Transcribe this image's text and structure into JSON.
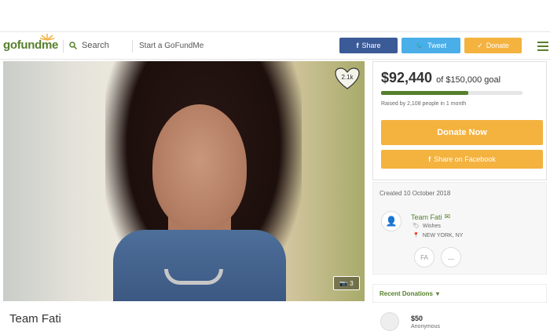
{
  "header": {
    "logo": "gofundme",
    "search_label": "Search",
    "start_label": "Start a GoFundMe",
    "share_label": "Share",
    "tweet_label": "Tweet",
    "donate_label": "Donate"
  },
  "hero": {
    "likes": "2.1k",
    "photos": "3"
  },
  "campaign": {
    "title": "Team Fati",
    "raised": "$92,440",
    "goal_text": "of $150,000 goal",
    "progress_fraction": 0.616,
    "raised_by": "Raised by 2,108 people in 1 month",
    "donate_now": "Donate Now",
    "share_facebook": "Share on Facebook"
  },
  "organizer": {
    "created": "Created 10 October 2018",
    "name": "Team Fati",
    "category": "Wishes",
    "location": "NEW YORK, NY",
    "initials": "FA",
    "more": "..."
  },
  "recent": {
    "title": "Recent Donations",
    "amount": "$50",
    "name": "Anonymous"
  },
  "colors": {
    "brand_green": "#55802c",
    "facebook_blue": "#3b5a98",
    "twitter_blue": "#4aaee8",
    "donate_orange": "#f4b23f"
  }
}
